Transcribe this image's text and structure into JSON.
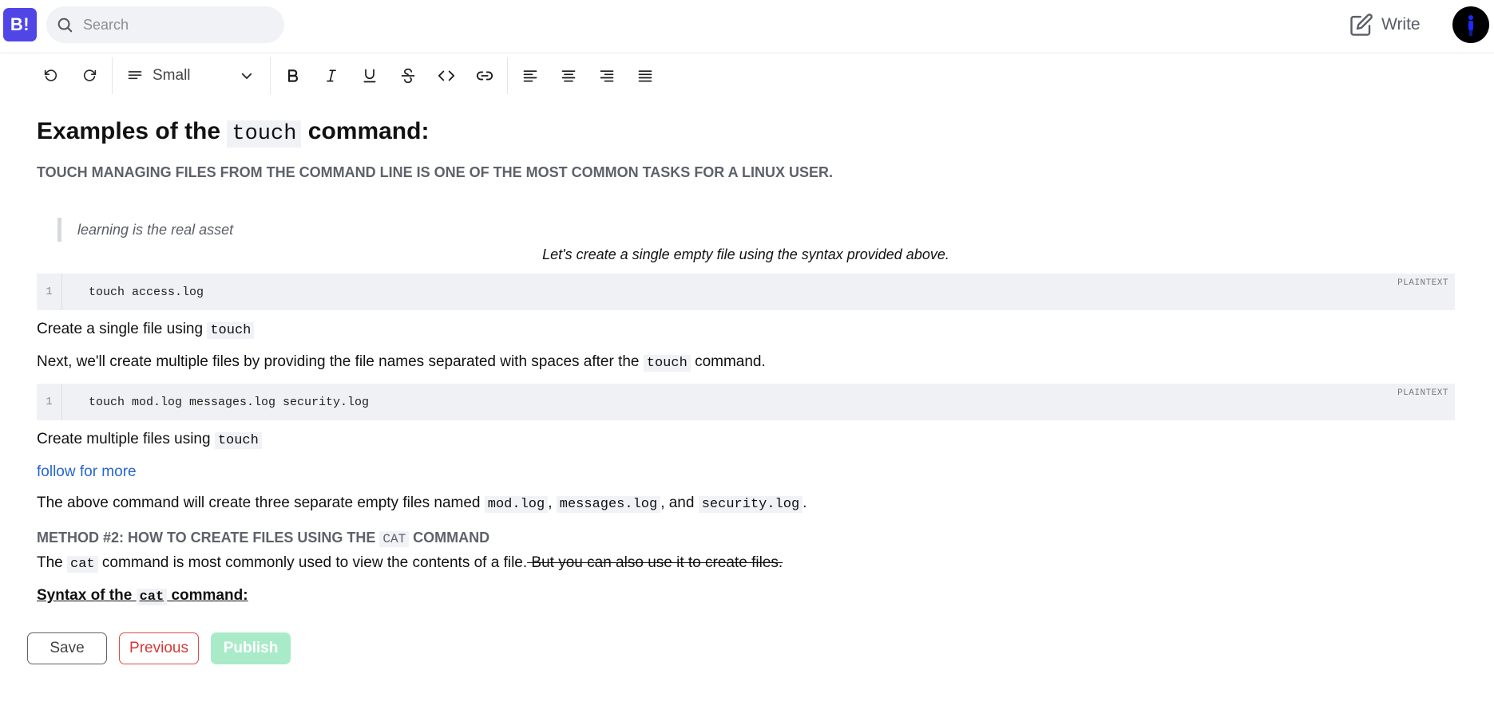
{
  "header": {
    "logo_text": "B!",
    "search_placeholder": "Search",
    "write_label": "Write",
    "accent_color": "#5046e5"
  },
  "toolbar": {
    "text_size": "Small",
    "icons": [
      "undo-icon",
      "redo-icon",
      "paragraph-size-icon",
      "chevron-down-icon",
      "bold-icon",
      "italic-icon",
      "underline-icon",
      "strikethrough-icon",
      "code-icon",
      "link-icon",
      "align-left-icon",
      "align-center-icon",
      "align-right-icon",
      "align-justify-icon"
    ]
  },
  "content": {
    "heading_part1": "Examples of the ",
    "heading_code": "touch",
    "heading_part2": " command:",
    "caps_line": "TOUCH  MANAGING FILES FROM THE COMMAND LINE IS ONE OF THE MOST COMMON TASKS FOR A LINUX USER.",
    "quote": "learning is the real asset",
    "centered_italic": "Let's create a single empty file using the syntax provided above.",
    "code1": {
      "line_no": "1",
      "code": "touch access.log",
      "lang": "PLAINTEXT"
    },
    "p1_text": "Create a single file using ",
    "p1_code": "touch",
    "p2_text": "Next, we'll create multiple files by providing the file names separated with spaces after the ",
    "p2_code": "touch",
    "p2_tail": " command.",
    "code2": {
      "line_no": "1",
      "code": "touch mod.log messages.log security.log",
      "lang": "PLAINTEXT"
    },
    "p3_text": "Create multiple files using ",
    "p3_code": "touch",
    "link_text": "follow for more",
    "p4_a": "The above command will create three separate empty files named ",
    "p4_code1": "mod.log",
    "p4_b": ", ",
    "p4_code2": "messages.log",
    "p4_c": ", and ",
    "p4_code3": "security.log",
    "p4_d": ".",
    "method_a": "METHOD #2: HOW TO CREATE FILES USING THE ",
    "method_code": "CAT",
    "method_b": " COMMAND",
    "p5_a": "The ",
    "p5_code": "cat",
    "p5_b": " command is most commonly used to view the contents of a file.",
    "p5_strike": " But you can also use it to create files.",
    "syntax_a": "Syntax of the ",
    "syntax_code": "cat",
    "syntax_b": " command:"
  },
  "actions": {
    "save": "Save",
    "previous": "Previous",
    "publish": "Publish"
  }
}
